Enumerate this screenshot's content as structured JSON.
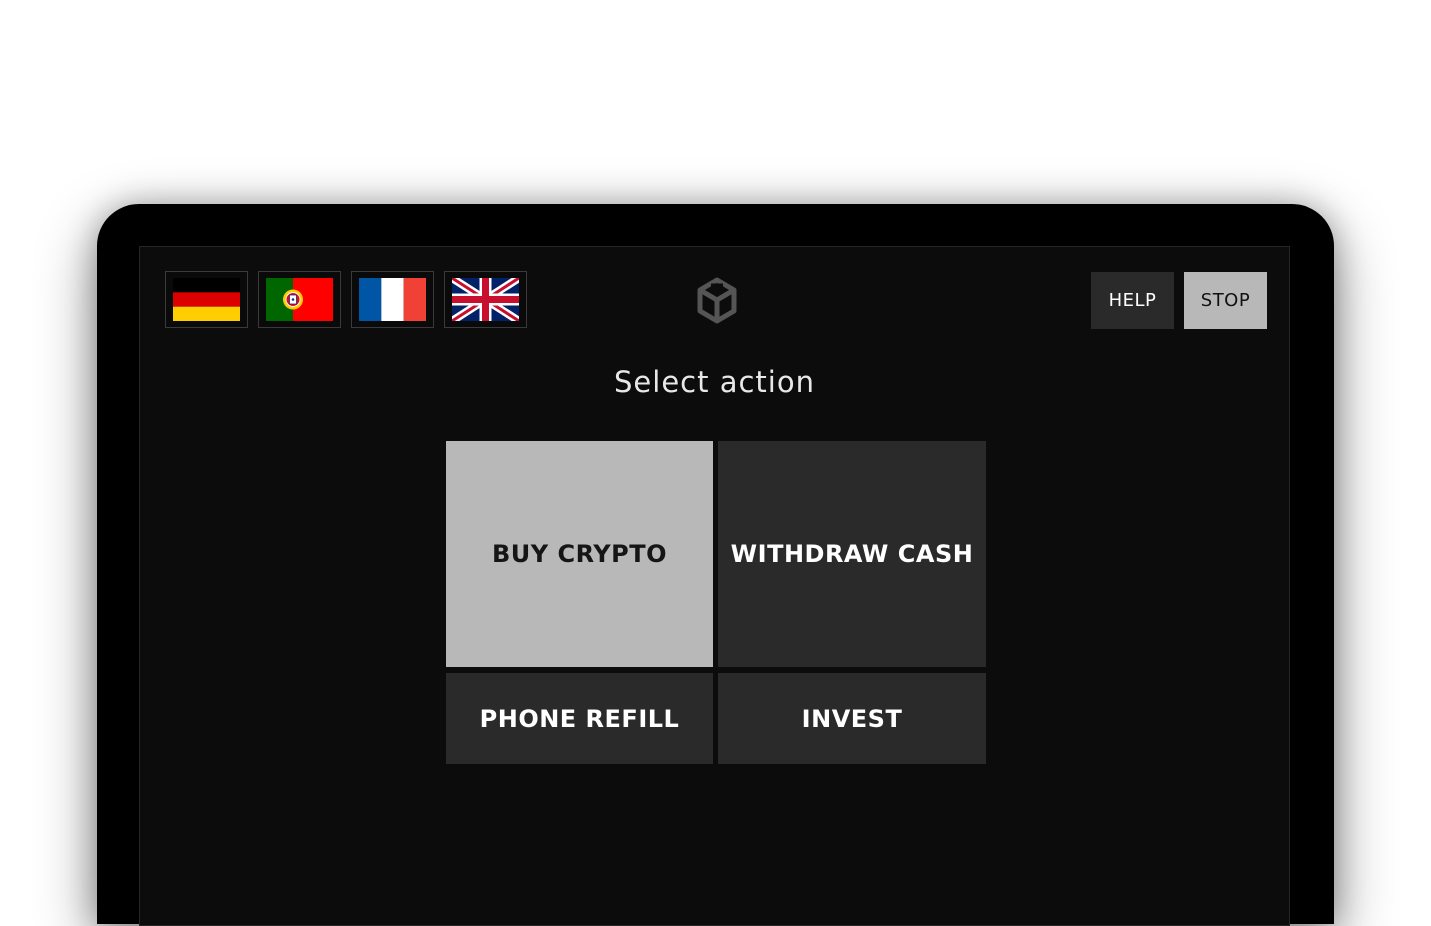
{
  "languages": [
    {
      "code": "de",
      "icon": "germany-flag-icon"
    },
    {
      "code": "pt",
      "icon": "portugal-flag-icon"
    },
    {
      "code": "fr",
      "icon": "france-flag-icon"
    },
    {
      "code": "en",
      "icon": "uk-flag-icon"
    }
  ],
  "logo": {
    "icon": "cube-logo-icon"
  },
  "header": {
    "help_label": "HELP",
    "stop_label": "STOP"
  },
  "main": {
    "title": "Select action",
    "actions": [
      {
        "label": "BUY CRYPTO",
        "style": "primary"
      },
      {
        "label": "WITHDRAW CASH",
        "style": "secondary"
      },
      {
        "label": "PHONE REFILL",
        "style": "secondary"
      },
      {
        "label": "INVEST",
        "style": "secondary"
      }
    ]
  },
  "colors": {
    "screen_bg": "#0c0c0c",
    "device_frame": "#000000",
    "primary_button": "#b8b8b8",
    "secondary_button": "#2a2a2a",
    "text_light": "#ffffff",
    "text_dark": "#151515"
  }
}
